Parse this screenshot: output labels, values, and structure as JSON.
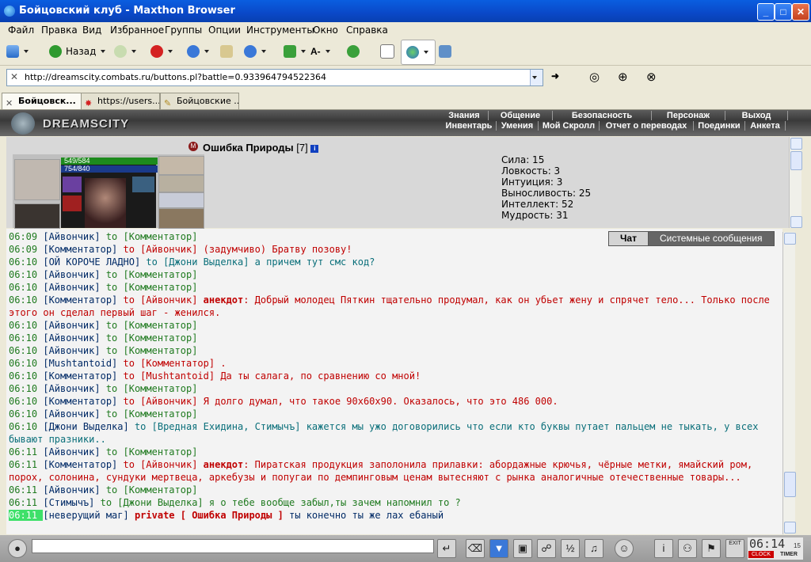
{
  "window": {
    "title": "Бойцовский клуб - Maxthon Browser"
  },
  "menu": [
    "Файл",
    "Правка",
    "Вид",
    "Избранное",
    "Группы",
    "Опции",
    "Инструменты",
    "Окно",
    "Справка"
  ],
  "toolbar": {
    "back_label": "Назад"
  },
  "address": {
    "url": "http://dreamscity.combats.ru/buttons.pl?battle=0.933964794522364"
  },
  "tabs": [
    {
      "label": "Бойцовск...",
      "active": true
    },
    {
      "label": "https://users....",
      "active": false
    },
    {
      "label": "Бойцовские ...",
      "active": false
    }
  ],
  "game": {
    "logo_text": "DREAMSCITY",
    "nav_top": [
      "Знания",
      "Общение",
      "Безопасность",
      "Персонаж",
      "Выход"
    ],
    "nav_bottom": [
      "Инвентарь",
      "Умения",
      "Мой Скролл",
      "Отчет о переводах",
      "Поединки",
      "Анкета"
    ]
  },
  "character": {
    "name": "Ошибка Природы",
    "level": "[7]",
    "info_badge": "i",
    "hp": "549/584",
    "mana": "754/840",
    "stats": [
      "Сила: 15",
      "Ловкость: 3",
      "Интуиция: 3",
      "Выносливость: 25",
      "Интеллект: 52",
      "Мудрость: 31"
    ]
  },
  "chat": {
    "tabs": [
      "Чат",
      "Системные сообщения"
    ],
    "lines": [
      [
        [
          "time",
          "06:09"
        ],
        [
          "sender",
          "[Айвончик]"
        ],
        [
          "to",
          " to [Комментатор]"
        ]
      ],
      [
        [
          "time",
          "06:09"
        ],
        [
          "sender",
          "[Комментатор]"
        ],
        [
          "red",
          " to [Айвончик] (задумчиво) Братву позову!"
        ]
      ],
      [
        [
          "time",
          "06:10"
        ],
        [
          "sender",
          "[ОЙ КОРОЧЕ ЛАДНО]"
        ],
        [
          "teal",
          " to [Джони Выделка] а причем тут смс код?"
        ]
      ],
      [
        [
          "time",
          "06:10"
        ],
        [
          "sender",
          "[Айвончик]"
        ],
        [
          "to",
          " to [Комментатор]"
        ]
      ],
      [
        [
          "time",
          "06:10"
        ],
        [
          "sender",
          "[Айвончик]"
        ],
        [
          "to",
          " to [Комментатор]"
        ]
      ],
      [
        [
          "time",
          "06:10"
        ],
        [
          "sender",
          "[Комментатор]"
        ],
        [
          "red",
          " to [Айвончик] "
        ],
        [
          "anek",
          "анекдот"
        ],
        [
          "red",
          ": Добрый молодец Пяткин тщательно продумал, как он убьет жену и спрячет тело... Только после этого он сделал первый шаг - женился."
        ]
      ],
      [
        [
          "time",
          "06:10"
        ],
        [
          "sender",
          "[Айвончик]"
        ],
        [
          "to",
          " to [Комментатор]"
        ]
      ],
      [
        [
          "time",
          "06:10"
        ],
        [
          "sender",
          "[Айвончик]"
        ],
        [
          "to",
          " to [Комментатор]"
        ]
      ],
      [
        [
          "time",
          "06:10"
        ],
        [
          "sender",
          "[Айвончик]"
        ],
        [
          "to",
          " to [Комментатор]"
        ]
      ],
      [
        [
          "time",
          "06:10"
        ],
        [
          "sender",
          "[Mushtantoid]"
        ],
        [
          "red",
          " to [Комментатор] ."
        ]
      ],
      [
        [
          "time",
          "06:10"
        ],
        [
          "sender",
          "[Комментатор]"
        ],
        [
          "red",
          " to [Mushtantoid] Да ты салага, по сравнению со мной!"
        ]
      ],
      [
        [
          "time",
          "06:10"
        ],
        [
          "sender",
          "[Айвончик]"
        ],
        [
          "to",
          " to [Комментатор]"
        ]
      ],
      [
        [
          "time",
          "06:10"
        ],
        [
          "sender",
          "[Комментатор]"
        ],
        [
          "red",
          " to [Айвончик] Я долго думал, что такое 90х60х90. Оказалось, что это 486 000."
        ]
      ],
      [
        [
          "time",
          "06:10"
        ],
        [
          "sender",
          "[Айвончик]"
        ],
        [
          "to",
          " to [Комментатор]"
        ]
      ],
      [
        [
          "time",
          "06:10"
        ],
        [
          "sender",
          "[Джони Выделка]"
        ],
        [
          "teal",
          " to [Вредная Ехидина, Стимычъ] кажется мы ужо договорились что если кто буквы путает пальцем не тыкать, у всех бывают празники.."
        ]
      ],
      [
        [
          "time",
          "06:11"
        ],
        [
          "sender",
          "[Айвончик]"
        ],
        [
          "to",
          " to [Комментатор]"
        ]
      ],
      [
        [
          "time",
          "06:11"
        ],
        [
          "sender",
          "[Комментатор]"
        ],
        [
          "red",
          " to [Айвончик] "
        ],
        [
          "anek",
          "анекдот"
        ],
        [
          "red",
          ": Пиратская продукция заполонила прилавки: абордажные крючья, чёрные метки, ямайский ром, порох, солонина, сундуки мертвеца, аркебузы и попугаи по демпинговым ценам вытесняют с рынка аналогичные отечественные товары..."
        ]
      ],
      [
        [
          "time",
          "06:11"
        ],
        [
          "sender",
          "[Айвончик]"
        ],
        [
          "to",
          " to [Комментатор]"
        ]
      ],
      [
        [
          "time",
          "06:11"
        ],
        [
          "sender",
          "[Стимычъ]"
        ],
        [
          "to",
          " to [Джони Выделка] я о тебе вообще забыл,ты зачем напомнил то ?"
        ]
      ],
      [
        [
          "timehl",
          "06:11"
        ],
        [
          "sender",
          "[неверущий маг]"
        ],
        [
          "private",
          " private [ Ошибка Природы ]"
        ],
        [
          "dblue",
          " ты конечно ты же лах ебаный"
        ]
      ]
    ]
  },
  "clock": {
    "time": "06:14",
    "seconds": "15",
    "clock_label": "CLOCK",
    "timer_label": "TIMER",
    "exit_label": "EXIT"
  }
}
